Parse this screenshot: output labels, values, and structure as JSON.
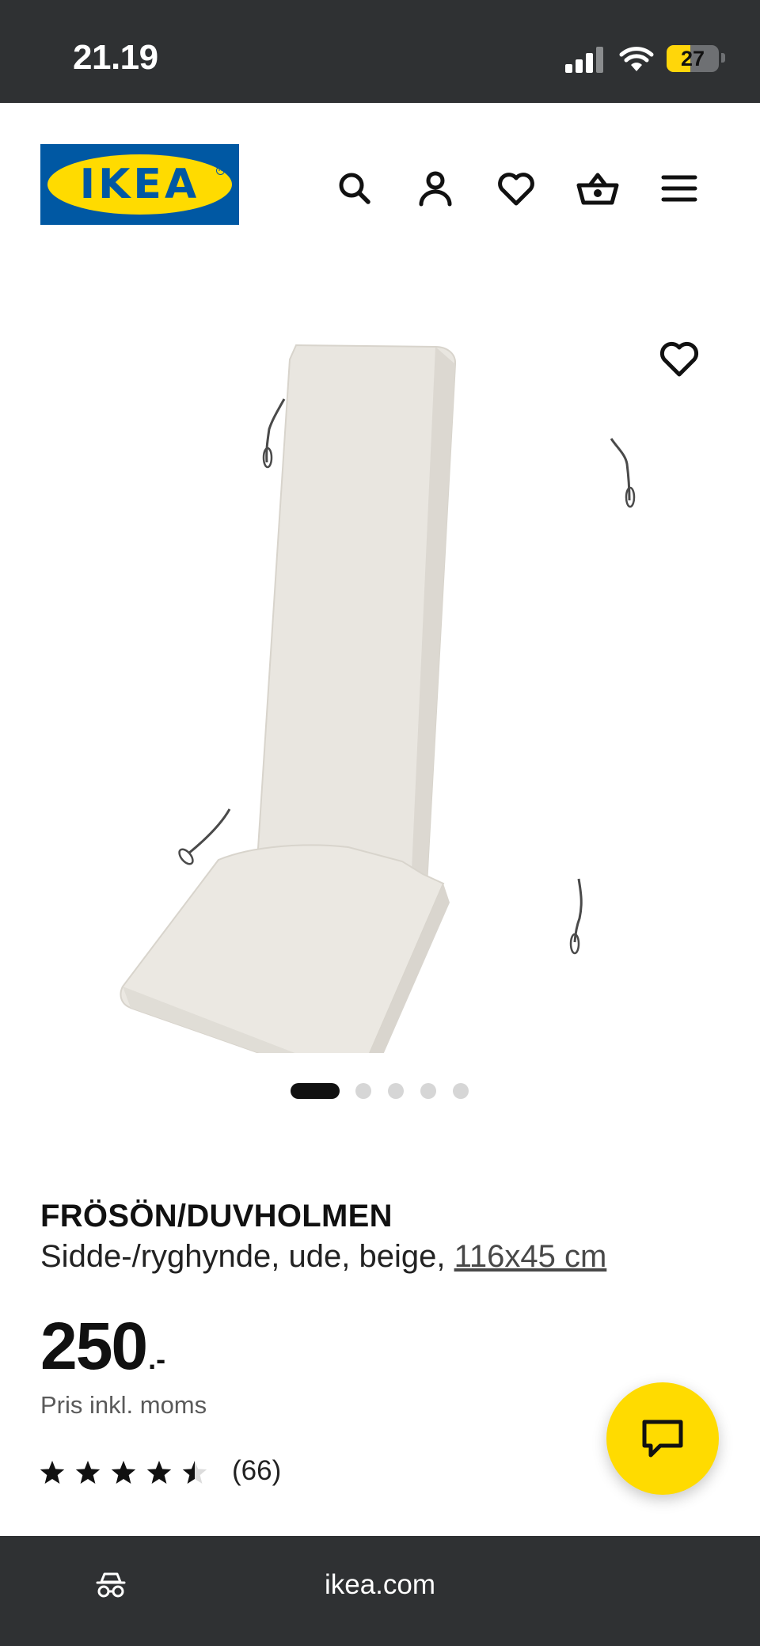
{
  "status_bar": {
    "time": "21.19",
    "battery_level": "27"
  },
  "header": {
    "logo_text": "IKEA",
    "icons": [
      "search-icon",
      "account-icon",
      "heart-icon",
      "basket-icon",
      "menu-icon"
    ]
  },
  "gallery": {
    "image_count": 5,
    "active_index": 0
  },
  "product": {
    "name": "FRÖSÖN/DUVHOLMEN",
    "description": "Sidde-/ryghynde, ude, beige, ",
    "size_link": "116x45 cm",
    "price_integer": "250",
    "price_suffix": ".-",
    "price_note": "Pris inkl. moms",
    "rating": 4.5,
    "rating_max": 5,
    "review_count": "(66)"
  },
  "browser": {
    "url": "ikea.com"
  },
  "colors": {
    "ikea_blue": "#0058a3",
    "ikea_yellow": "#ffdb00",
    "bar_dark": "#2f3133"
  }
}
